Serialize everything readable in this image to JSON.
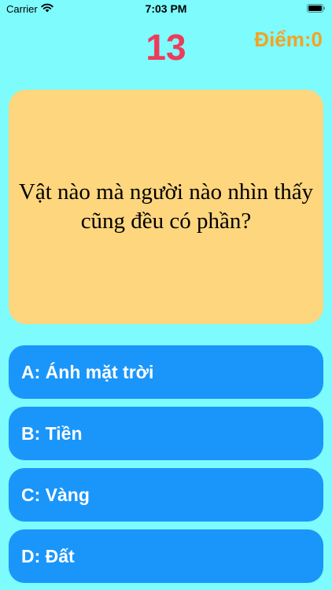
{
  "status_bar": {
    "carrier": "Carrier",
    "time": "7:03 PM",
    "wifi_icon": "wifi-icon",
    "battery_icon": "battery-icon"
  },
  "quiz": {
    "timer": "13",
    "score": "Điểm:0",
    "question": "Vật nào mà người nào nhìn thấy cũng đều có phần?",
    "answers": [
      {
        "label": "A: Ánh mặt trời"
      },
      {
        "label": "B: Tiền"
      },
      {
        "label": "C: Vàng"
      },
      {
        "label": "D: Đất"
      }
    ]
  },
  "colors": {
    "background": "#7dfbfd",
    "timer": "#ee3b5b",
    "score": "#f5a223",
    "question_card": "#fed67e",
    "answer_button": "#1a96fb",
    "answer_text": "#ffffff"
  }
}
